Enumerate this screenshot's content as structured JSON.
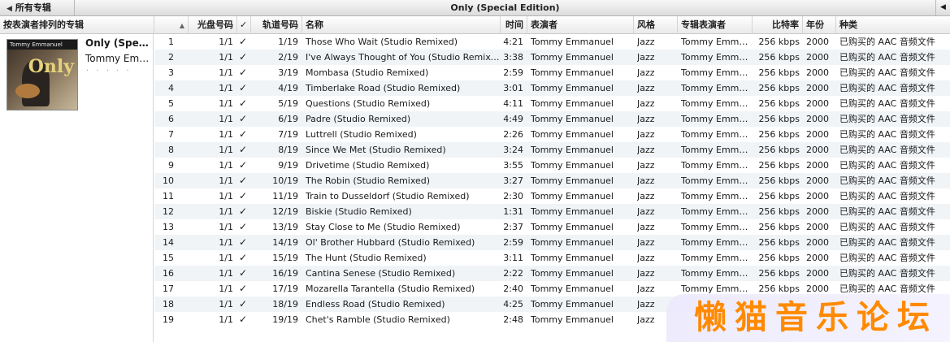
{
  "topbar": {
    "back_label": "所有专辑",
    "album_title": "Only (Special Edition)"
  },
  "columns": {
    "album_pane": "按表演者排列的专辑",
    "disc": "光盘号码",
    "check": "✓",
    "track": "轨道号码",
    "name": "名称",
    "time": "时间",
    "artist": "表演者",
    "genre": "风格",
    "album_artist": "专辑表演者",
    "bitrate": "比特率",
    "year": "年份",
    "kind": "种类"
  },
  "album": {
    "name": "Only (Special Edition)",
    "artist": "Tommy Emmanuel",
    "rating": "· · · · ·",
    "cover_header": "Tommy Emmanuel",
    "cover_word": "Only"
  },
  "tracks": [
    {
      "n": "1",
      "disc": "1/1",
      "track": "1/19",
      "name": "Those Who Wait (Studio Remixed)",
      "time": "4:21",
      "artist": "Tommy Emmanuel",
      "genre": "Jazz",
      "album_artist": "Tommy Emmanuel",
      "bitrate": "256 kbps",
      "year": "2000",
      "kind": "已购买的 AAC 音频文件"
    },
    {
      "n": "2",
      "disc": "1/1",
      "track": "2/19",
      "name": "I've Always Thought of You (Studio Remixed)",
      "time": "3:38",
      "artist": "Tommy Emmanuel",
      "genre": "Jazz",
      "album_artist": "Tommy Emmanuel",
      "bitrate": "256 kbps",
      "year": "2000",
      "kind": "已购买的 AAC 音频文件"
    },
    {
      "n": "3",
      "disc": "1/1",
      "track": "3/19",
      "name": "Mombasa (Studio Remixed)",
      "time": "2:59",
      "artist": "Tommy Emmanuel",
      "genre": "Jazz",
      "album_artist": "Tommy Emmanuel",
      "bitrate": "256 kbps",
      "year": "2000",
      "kind": "已购买的 AAC 音频文件"
    },
    {
      "n": "4",
      "disc": "1/1",
      "track": "4/19",
      "name": "Timberlake Road (Studio Remixed)",
      "time": "3:01",
      "artist": "Tommy Emmanuel",
      "genre": "Jazz",
      "album_artist": "Tommy Emmanuel",
      "bitrate": "256 kbps",
      "year": "2000",
      "kind": "已购买的 AAC 音频文件"
    },
    {
      "n": "5",
      "disc": "1/1",
      "track": "5/19",
      "name": "Questions (Studio Remixed)",
      "time": "4:11",
      "artist": "Tommy Emmanuel",
      "genre": "Jazz",
      "album_artist": "Tommy Emmanuel",
      "bitrate": "256 kbps",
      "year": "2000",
      "kind": "已购买的 AAC 音频文件"
    },
    {
      "n": "6",
      "disc": "1/1",
      "track": "6/19",
      "name": "Padre (Studio Remixed)",
      "time": "4:49",
      "artist": "Tommy Emmanuel",
      "genre": "Jazz",
      "album_artist": "Tommy Emmanuel",
      "bitrate": "256 kbps",
      "year": "2000",
      "kind": "已购买的 AAC 音频文件"
    },
    {
      "n": "7",
      "disc": "1/1",
      "track": "7/19",
      "name": "Luttrell (Studio Remixed)",
      "time": "2:26",
      "artist": "Tommy Emmanuel",
      "genre": "Jazz",
      "album_artist": "Tommy Emmanuel",
      "bitrate": "256 kbps",
      "year": "2000",
      "kind": "已购买的 AAC 音频文件"
    },
    {
      "n": "8",
      "disc": "1/1",
      "track": "8/19",
      "name": "Since We Met (Studio Remixed)",
      "time": "3:24",
      "artist": "Tommy Emmanuel",
      "genre": "Jazz",
      "album_artist": "Tommy Emmanuel",
      "bitrate": "256 kbps",
      "year": "2000",
      "kind": "已购买的 AAC 音频文件"
    },
    {
      "n": "9",
      "disc": "1/1",
      "track": "9/19",
      "name": "Drivetime (Studio Remixed)",
      "time": "3:55",
      "artist": "Tommy Emmanuel",
      "genre": "Jazz",
      "album_artist": "Tommy Emmanuel",
      "bitrate": "256 kbps",
      "year": "2000",
      "kind": "已购买的 AAC 音频文件"
    },
    {
      "n": "10",
      "disc": "1/1",
      "track": "10/19",
      "name": "The Robin (Studio Remixed)",
      "time": "3:27",
      "artist": "Tommy Emmanuel",
      "genre": "Jazz",
      "album_artist": "Tommy Emmanuel",
      "bitrate": "256 kbps",
      "year": "2000",
      "kind": "已购买的 AAC 音频文件"
    },
    {
      "n": "11",
      "disc": "1/1",
      "track": "11/19",
      "name": "Train to Dusseldorf (Studio Remixed)",
      "time": "2:30",
      "artist": "Tommy Emmanuel",
      "genre": "Jazz",
      "album_artist": "Tommy Emmanuel",
      "bitrate": "256 kbps",
      "year": "2000",
      "kind": "已购买的 AAC 音频文件"
    },
    {
      "n": "12",
      "disc": "1/1",
      "track": "12/19",
      "name": "Biskie (Studio Remixed)",
      "time": "1:31",
      "artist": "Tommy Emmanuel",
      "genre": "Jazz",
      "album_artist": "Tommy Emmanuel",
      "bitrate": "256 kbps",
      "year": "2000",
      "kind": "已购买的 AAC 音频文件"
    },
    {
      "n": "13",
      "disc": "1/1",
      "track": "13/19",
      "name": "Stay Close to Me (Studio Remixed)",
      "time": "2:37",
      "artist": "Tommy Emmanuel",
      "genre": "Jazz",
      "album_artist": "Tommy Emmanuel",
      "bitrate": "256 kbps",
      "year": "2000",
      "kind": "已购买的 AAC 音频文件"
    },
    {
      "n": "14",
      "disc": "1/1",
      "track": "14/19",
      "name": "Ol' Brother Hubbard (Studio Remixed)",
      "time": "2:59",
      "artist": "Tommy Emmanuel",
      "genre": "Jazz",
      "album_artist": "Tommy Emmanuel",
      "bitrate": "256 kbps",
      "year": "2000",
      "kind": "已购买的 AAC 音频文件"
    },
    {
      "n": "15",
      "disc": "1/1",
      "track": "15/19",
      "name": "The Hunt (Studio Remixed)",
      "time": "3:11",
      "artist": "Tommy Emmanuel",
      "genre": "Jazz",
      "album_artist": "Tommy Emmanuel",
      "bitrate": "256 kbps",
      "year": "2000",
      "kind": "已购买的 AAC 音频文件"
    },
    {
      "n": "16",
      "disc": "1/1",
      "track": "16/19",
      "name": "Cantina Senese (Studio Remixed)",
      "time": "2:22",
      "artist": "Tommy Emmanuel",
      "genre": "Jazz",
      "album_artist": "Tommy Emmanuel",
      "bitrate": "256 kbps",
      "year": "2000",
      "kind": "已购买的 AAC 音频文件"
    },
    {
      "n": "17",
      "disc": "1/1",
      "track": "17/19",
      "name": "Mozarella Tarantella (Studio Remixed)",
      "time": "2:40",
      "artist": "Tommy Emmanuel",
      "genre": "Jazz",
      "album_artist": "Tommy Emmanuel",
      "bitrate": "256 kbps",
      "year": "2000",
      "kind": "已购买的 AAC 音频文件"
    },
    {
      "n": "18",
      "disc": "1/1",
      "track": "18/19",
      "name": "Endless Road (Studio Remixed)",
      "time": "4:25",
      "artist": "Tommy Emmanuel",
      "genre": "Jazz",
      "album_artist": "",
      "bitrate": "",
      "year": "",
      "kind": ""
    },
    {
      "n": "19",
      "disc": "1/1",
      "track": "19/19",
      "name": "Chet's Ramble (Studio Remixed)",
      "time": "2:48",
      "artist": "Tommy Emmanuel",
      "genre": "Jazz",
      "album_artist": "",
      "bitrate": "",
      "year": "",
      "kind": ""
    }
  ],
  "watermark": {
    "text": "懒猫音乐论坛",
    "color": "#ff8a00"
  },
  "colors": {
    "row_alt": "#f1f4f7",
    "header_bg": "#eaeaea"
  }
}
